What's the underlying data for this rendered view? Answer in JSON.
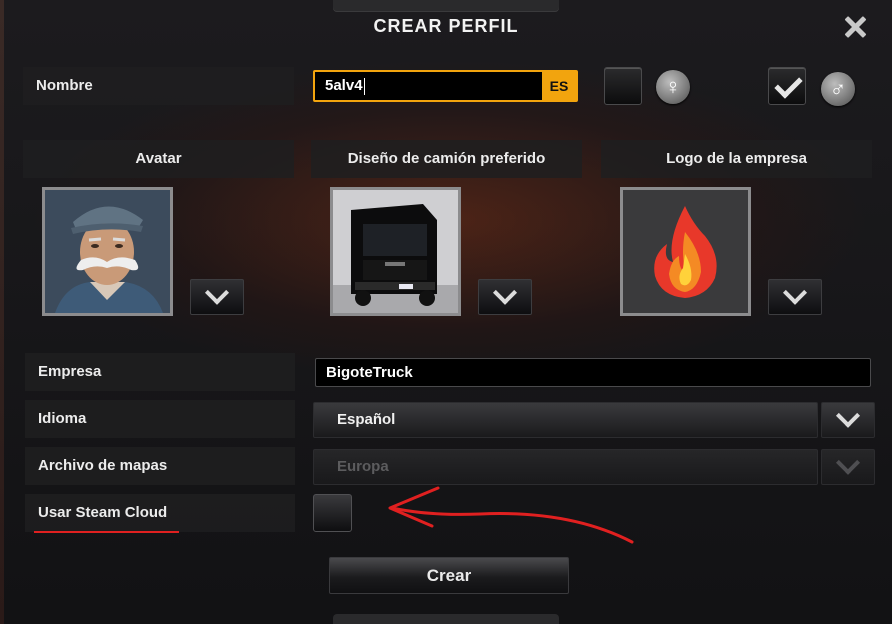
{
  "window": {
    "title": "CREAR PERFIL",
    "close_icon": "close-icon"
  },
  "profile": {
    "name_label": "Nombre",
    "name_value": "5alv4",
    "name_lang_badge": "ES",
    "female_icon_glyph": "♀",
    "male_icon_glyph": "♂",
    "female_checked": false,
    "male_checked": true
  },
  "sections": {
    "avatar_label": "Avatar",
    "truck_label": "Diseño de camión preferido",
    "logo_label": "Logo de la empresa"
  },
  "form": {
    "company_label": "Empresa",
    "company_value": "BigoteTruck",
    "language_label": "Idioma",
    "language_value": "Español",
    "map_label": "Archivo de mapas",
    "map_value": "Europa",
    "steam_label": "Usar Steam Cloud",
    "steam_checked": false
  },
  "actions": {
    "create_label": "Crear"
  },
  "colors": {
    "accent": "#f2a40e",
    "annotation": "#e02020"
  }
}
